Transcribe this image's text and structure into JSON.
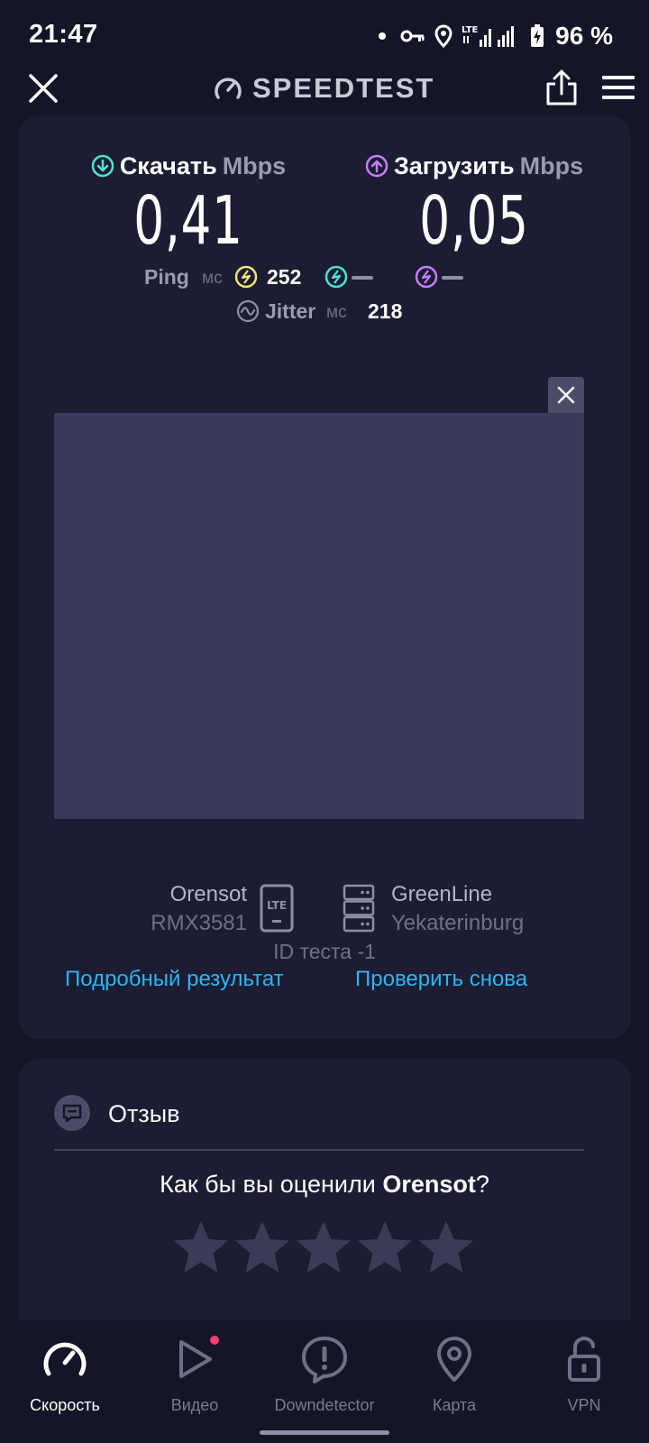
{
  "status_bar": {
    "time": "21:47",
    "network": "LTE",
    "battery": "96 %"
  },
  "header": {
    "brand": "SPEEDTEST",
    "icons": [
      "close-icon",
      "speedometer-icon",
      "share-icon",
      "menu-icon"
    ]
  },
  "result": {
    "download": {
      "label": "Скачать",
      "unit": "Mbps",
      "value": "0,41",
      "color": "#4fe3d0"
    },
    "upload": {
      "label": "Загрузить",
      "unit": "Mbps",
      "value": "0,05",
      "color": "#c77dff"
    },
    "ping": {
      "label": "Ping",
      "unit": "мс",
      "idle_value": "252",
      "idle_color": "#f4e27a"
    },
    "jitter": {
      "label": "Jitter",
      "unit": "мс",
      "value": "218"
    },
    "provider": {
      "name": "Orensot",
      "device": "RMX3581",
      "connection": "LTE"
    },
    "server": {
      "name": "GreenLine",
      "city": "Yekaterinburg"
    },
    "test_id": "ID теста -1",
    "detail_link": "Подробный результат",
    "retry_link": "Проверить снова"
  },
  "feedback": {
    "title": "Отзыв",
    "question_prefix": "Как бы вы оценили ",
    "question_provider": "Orensot",
    "question_suffix": "?",
    "stars": 5
  },
  "nav": {
    "items": [
      {
        "label": "Скорость",
        "icon": "speed-icon",
        "active": true
      },
      {
        "label": "Видео",
        "icon": "play-icon",
        "active": false,
        "badge": true
      },
      {
        "label": "Downdetector",
        "icon": "alert-icon",
        "active": false
      },
      {
        "label": "Карта",
        "icon": "map-pin-icon",
        "active": false
      },
      {
        "label": "VPN",
        "icon": "unlock-icon",
        "active": false
      }
    ]
  },
  "colors": {
    "background": "#141526",
    "card": "#1c1d33",
    "link": "#2eb4f0",
    "badge": "#ff3d6a"
  }
}
